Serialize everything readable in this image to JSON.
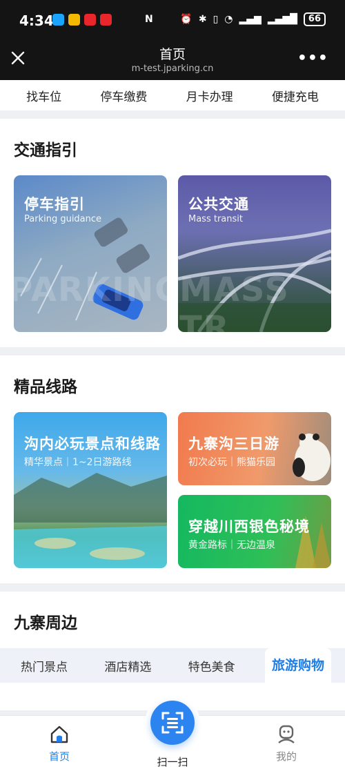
{
  "status_bar": {
    "time": "4:34",
    "battery": "66"
  },
  "title_bar": {
    "title": "首页",
    "url": "m-test.jparking.cn"
  },
  "quick_nav": [
    {
      "label": "找车位"
    },
    {
      "label": "停车缴费"
    },
    {
      "label": "月卡办理"
    },
    {
      "label": "便捷充电"
    }
  ],
  "traffic": {
    "title": "交通指引",
    "cards": [
      {
        "title": "停车指引",
        "subtitle": "Parking guidance",
        "watermark": "PARKING"
      },
      {
        "title": "公共交通",
        "subtitle": "Mass transit",
        "watermark": "MASS TR"
      }
    ]
  },
  "routes": {
    "title": "精品线路",
    "cards": [
      {
        "title": "沟内必玩景点和线路",
        "subtitle": "精华景点｜1~2日游路线"
      },
      {
        "title": "九寨沟三日游",
        "subtitle": "初次必玩｜熊猫乐园"
      },
      {
        "title": "穿越川西银色秘境",
        "subtitle": "黄金路标｜无边温泉"
      }
    ]
  },
  "nearby": {
    "title": "九寨周边",
    "tabs": [
      {
        "label": "热门景点"
      },
      {
        "label": "酒店精选"
      },
      {
        "label": "特色美食"
      },
      {
        "label": "旅游购物"
      }
    ],
    "active_tab": 3
  },
  "bottom_nav": {
    "home": "首页",
    "scan": "扫一扫",
    "me": "我的"
  },
  "colors": {
    "accent": "#1f7ee8",
    "scan": "#2b84f0"
  }
}
